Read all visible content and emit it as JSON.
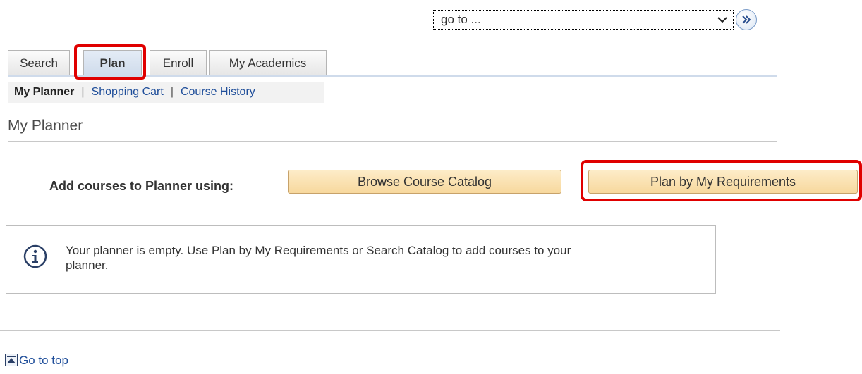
{
  "goto": {
    "selected": "go to ...",
    "icon": "chevron-down-icon",
    "go_icon": "double-chevron-right-icon"
  },
  "tabs": [
    {
      "label": "Search",
      "mnemonic": "S",
      "rest": "earch"
    },
    {
      "label": "Plan"
    },
    {
      "label": "Enroll",
      "mnemonic": "E",
      "rest": "nroll"
    },
    {
      "label": "My Academics",
      "mnemonic": "M",
      "rest": "y Academics"
    }
  ],
  "subnav": {
    "current": "My Planner",
    "separator": "|",
    "links": [
      {
        "mnemonic": "S",
        "rest": "hopping Cart"
      },
      {
        "mnemonic": "C",
        "rest": "ourse History"
      }
    ]
  },
  "page_title": "My Planner",
  "add": {
    "label": "Add courses to Planner using:",
    "browse_button": "Browse Course Catalog",
    "plan_button": "Plan by My Requirements"
  },
  "info": {
    "icon": "info-icon",
    "message": "Your planner is empty.  Use Plan by My Requirements or Search Catalog to add courses to your planner."
  },
  "footer": {
    "go_to_top": "Go to top",
    "icon": "go-to-top-icon"
  },
  "colors": {
    "highlight": "#e00000",
    "button_bg": "#f7d89d",
    "link": "#1f4e9a",
    "active_tab": "#cfdbeb"
  }
}
